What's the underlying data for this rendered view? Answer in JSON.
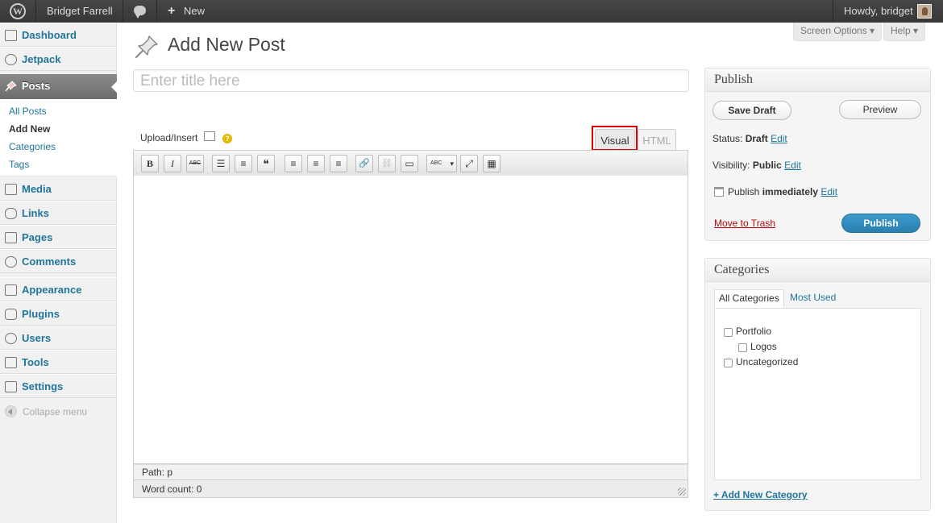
{
  "admin_bar": {
    "site_name": "Bridget Farrell",
    "new_label": "New",
    "howdy": "Howdy, bridget"
  },
  "sidebar": {
    "items": [
      {
        "label": "Dashboard",
        "icon": "dashboard-icon"
      },
      {
        "label": "Jetpack",
        "icon": "jetpack-icon"
      },
      {
        "label": "Posts",
        "icon": "pin-icon"
      },
      {
        "label": "Media",
        "icon": "media-icon"
      },
      {
        "label": "Links",
        "icon": "links-icon"
      },
      {
        "label": "Pages",
        "icon": "pages-icon"
      },
      {
        "label": "Comments",
        "icon": "comments-icon"
      },
      {
        "label": "Appearance",
        "icon": "appearance-icon"
      },
      {
        "label": "Plugins",
        "icon": "plugins-icon"
      },
      {
        "label": "Users",
        "icon": "users-icon"
      },
      {
        "label": "Tools",
        "icon": "tools-icon"
      },
      {
        "label": "Settings",
        "icon": "settings-icon"
      }
    ],
    "submenu": [
      "All Posts",
      "Add New",
      "Categories",
      "Tags"
    ],
    "collapse": "Collapse menu"
  },
  "screen_meta": {
    "screen_options": "Screen Options ▾",
    "help": "Help ▾"
  },
  "page": {
    "title": "Add New Post",
    "title_placeholder": "Enter title here"
  },
  "editor": {
    "upload_insert": "Upload/Insert",
    "tab_visual": "Visual",
    "tab_html": "HTML",
    "toolbar": [
      "B",
      "I",
      "ABC",
      "☰",
      "≡",
      "❝",
      "≡",
      "≡",
      "≡",
      "🔗",
      "⛓",
      "▭",
      "ABC",
      "⤢",
      "▦"
    ],
    "path_label": "Path:",
    "path_value": "p",
    "word_count": "Word count: 0"
  },
  "publish": {
    "heading": "Publish",
    "save_draft": "Save Draft",
    "preview": "Preview",
    "status_label": "Status:",
    "status_value": "Draft",
    "visibility_label": "Visibility:",
    "visibility_value": "Public",
    "publish_label": "Publish",
    "publish_value": "immediately",
    "edit": "Edit",
    "move_to_trash": "Move to Trash",
    "publish_button": "Publish"
  },
  "categories": {
    "heading": "Categories",
    "tab_all": "All Categories",
    "tab_most_used": "Most Used",
    "items": [
      "Portfolio",
      "Logos",
      "Uncategorized"
    ],
    "add_new": "+ Add New Category"
  },
  "colors": {
    "link": "#21759b",
    "adminbar": "#464646",
    "primary_button": "#2a7fb0",
    "trash": "#bc0b0b",
    "highlight": "#dd0000"
  }
}
